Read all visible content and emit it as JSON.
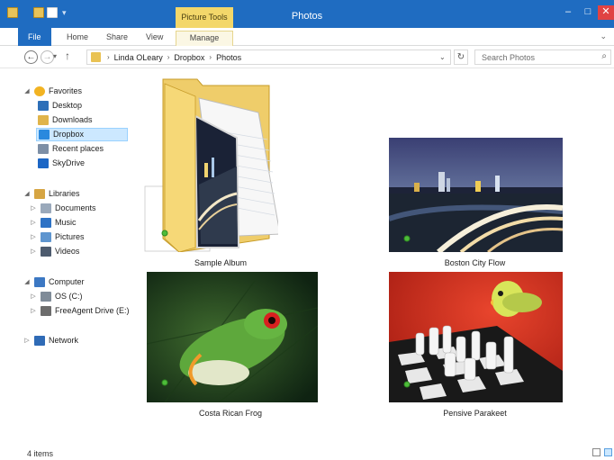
{
  "window": {
    "title": "Photos",
    "contextual_tab_group": "Picture Tools",
    "controls": {
      "minimize": "–",
      "maximize": "□",
      "close": "✕"
    }
  },
  "ribbon": {
    "tabs": [
      "File",
      "Home",
      "Share",
      "View",
      "Manage"
    ],
    "expand_glyph": "⌄"
  },
  "address_bar": {
    "back_glyph": "←",
    "forward_glyph": "→",
    "recent_glyph": "▾",
    "up_glyph": "↑",
    "breadcrumb": [
      "Linda OLeary",
      "Dropbox",
      "Photos"
    ],
    "crumb_separator": "›",
    "dropdown_glyph": "⌄",
    "refresh_glyph": "↻",
    "search_placeholder": "Search Photos",
    "search_glyph": "⌕"
  },
  "navigation": {
    "items": [
      {
        "label": "Favorites",
        "icon": "star-icon",
        "arrow": "◢",
        "indent": 0
      },
      {
        "label": "Desktop",
        "icon": "desktop-icon",
        "arrow": "",
        "indent": 1
      },
      {
        "label": "Downloads",
        "icon": "downloads-icon",
        "arrow": "",
        "indent": 1
      },
      {
        "label": "Dropbox",
        "icon": "dropbox-icon",
        "arrow": "",
        "indent": 1,
        "selected": true
      },
      {
        "label": "Recent places",
        "icon": "recent-places-icon",
        "arrow": "",
        "indent": 1
      },
      {
        "label": "SkyDrive",
        "icon": "skydrive-icon",
        "arrow": "",
        "indent": 1
      },
      {
        "label": "Libraries",
        "icon": "libraries-icon",
        "arrow": "◢",
        "indent": 0
      },
      {
        "label": "Documents",
        "icon": "documents-icon",
        "arrow": "▷",
        "indent": 1
      },
      {
        "label": "Music",
        "icon": "music-icon",
        "arrow": "▷",
        "indent": 1
      },
      {
        "label": "Pictures",
        "icon": "pictures-icon",
        "arrow": "▷",
        "indent": 1
      },
      {
        "label": "Videos",
        "icon": "videos-icon",
        "arrow": "▷",
        "indent": 1
      },
      {
        "label": "Computer",
        "icon": "computer-icon",
        "arrow": "◢",
        "indent": 0
      },
      {
        "label": "OS (C:)",
        "icon": "drive-c-icon",
        "arrow": "▷",
        "indent": 1
      },
      {
        "label": "FreeAgent Drive (E:)",
        "icon": "drive-e-icon",
        "arrow": "▷",
        "indent": 1
      },
      {
        "label": "Network",
        "icon": "network-icon",
        "arrow": "▷",
        "indent": 0
      }
    ],
    "icon_colors": {
      "star-icon": "#f2b322",
      "desktop-icon": "#2d6fb8",
      "downloads-icon": "#e0b44a",
      "dropbox-icon": "#2a89de",
      "recent-places-icon": "#7d8fa6",
      "skydrive-icon": "#1c66c5",
      "libraries-icon": "#d6a543",
      "documents-icon": "#9aa9bb",
      "music-icon": "#2d72c5",
      "pictures-icon": "#5e95cf",
      "videos-icon": "#4d5b6e",
      "computer-icon": "#3c78c3",
      "drive-c-icon": "#7f8b98",
      "drive-e-icon": "#6c6c6c",
      "network-icon": "#2f6bb6"
    }
  },
  "items": [
    {
      "name": "Sample Album",
      "kind": "folder"
    },
    {
      "name": "Boston City Flow",
      "kind": "photo"
    },
    {
      "name": "Costa Rican Frog",
      "kind": "photo"
    },
    {
      "name": "Pensive Parakeet",
      "kind": "photo"
    }
  ],
  "status": {
    "item_count": "4 items"
  },
  "colors": {
    "titlebar": "#1f6cc1",
    "picture_tools": "#f3d76a",
    "selection": "#cce8ff",
    "sync_dot": "#4ebc3a"
  }
}
